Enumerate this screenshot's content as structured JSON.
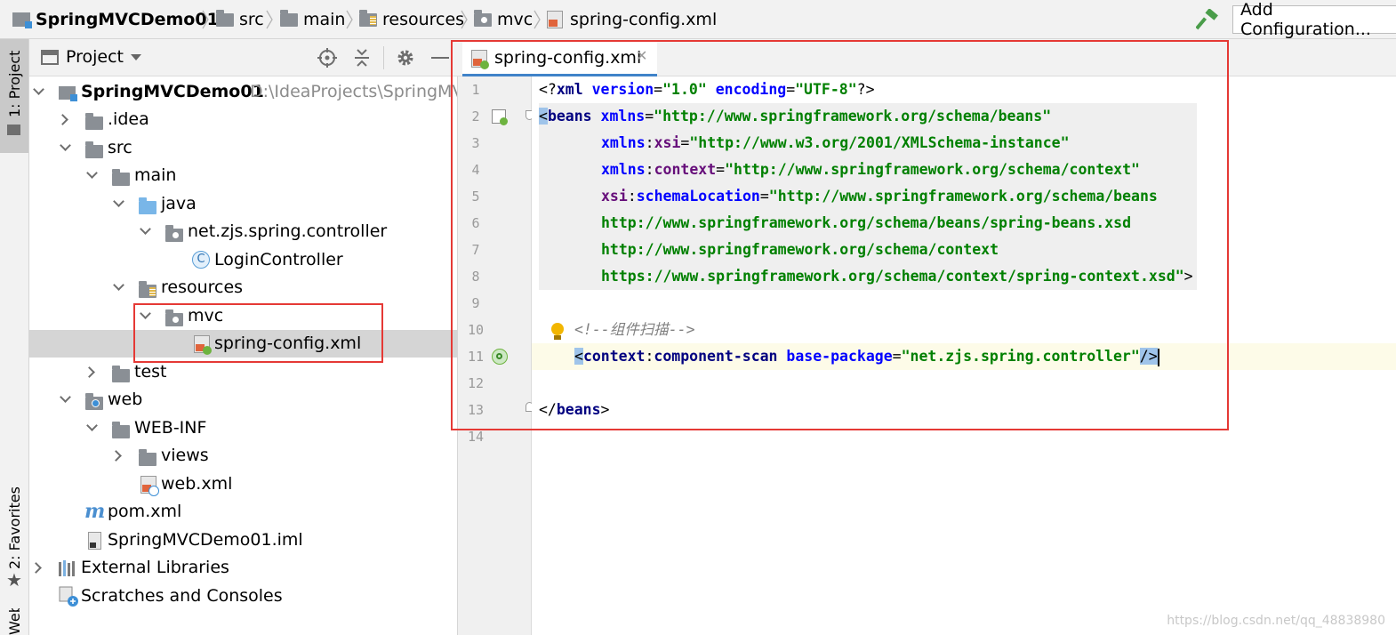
{
  "breadcrumb": [
    {
      "label": "SpringMVCDemo01",
      "icon": "module-icon"
    },
    {
      "label": "src",
      "icon": "folder-icon"
    },
    {
      "label": "main",
      "icon": "folder-icon"
    },
    {
      "label": "resources",
      "icon": "resources-folder-icon"
    },
    {
      "label": "mvc",
      "icon": "package-icon"
    },
    {
      "label": "spring-config.xml",
      "icon": "spring-xml-icon"
    }
  ],
  "toolbar": {
    "add_configuration": "Add Configuration...",
    "build_icon": "hammer-icon"
  },
  "side_tabs": {
    "project": "1: Project",
    "favorites": "2: Favorites",
    "web": "Web"
  },
  "project_panel": {
    "title": "Project"
  },
  "tree": {
    "root": {
      "label": "SpringMVCDemo01",
      "path": "D:\\IdeaProjects\\SpringMVC"
    },
    "idea": ".idea",
    "src": "src",
    "main": "main",
    "java": "java",
    "pkg": "net.zjs.spring.controller",
    "controller": "LoginController",
    "resources": "resources",
    "mvc": "mvc",
    "springcfg": "spring-config.xml",
    "test": "test",
    "web": "web",
    "webinf": "WEB-INF",
    "views": "views",
    "webxml": "web.xml",
    "pom": "pom.xml",
    "iml": "SpringMVCDemo01.iml",
    "extlib": "External Libraries",
    "scratches": "Scratches and Consoles"
  },
  "editor": {
    "tab_label": "spring-config.xml",
    "line_numbers": [
      "1",
      "2",
      "3",
      "4",
      "5",
      "6",
      "7",
      "8",
      "9",
      "10",
      "11",
      "12",
      "13",
      "14"
    ],
    "l1": {
      "a": "<?",
      "b": "xml",
      "c": " version",
      "d": "=",
      "e": "\"1.0\"",
      "f": " encoding",
      "g": "=",
      "h": "\"UTF-8\"",
      "i": "?>"
    },
    "l2": {
      "a": "<",
      "b": "beans",
      "c": " xmlns",
      "d": "=",
      "e": "\"http://www.springframework.org/schema/beans\""
    },
    "l3": {
      "a": "xmlns",
      "b": ":",
      "c": "xsi",
      "d": "=",
      "e": "\"http://www.w3.org/2001/XMLSchema-instance\""
    },
    "l4": {
      "a": "xmlns",
      "b": ":",
      "c": "context",
      "d": "=",
      "e": "\"http://www.springframework.org/schema/context\""
    },
    "l5": {
      "a": "xsi",
      "b": ":",
      "c": "schemaLocation",
      "d": "=",
      "e": "\"http://www.springframework.org/schema/beans"
    },
    "l6": "http://www.springframework.org/schema/beans/spring-beans.xsd",
    "l7": "http://www.springframework.org/schema/context",
    "l8": {
      "a": "https://www.springframework.org/schema/context/spring-context.xsd\"",
      "b": ">"
    },
    "l10": "<!--组件扫描-->",
    "l11": {
      "a": "<",
      "b": "context",
      "c": ":",
      "d": "component-scan",
      "e": " base-package",
      "f": "=",
      "g": "\"net.zjs.spring.controller\"",
      "h": "/>"
    },
    "l13": {
      "a": "</",
      "b": "beans",
      "c": ">"
    }
  },
  "watermark": "https://blog.csdn.net/qq_48838980"
}
